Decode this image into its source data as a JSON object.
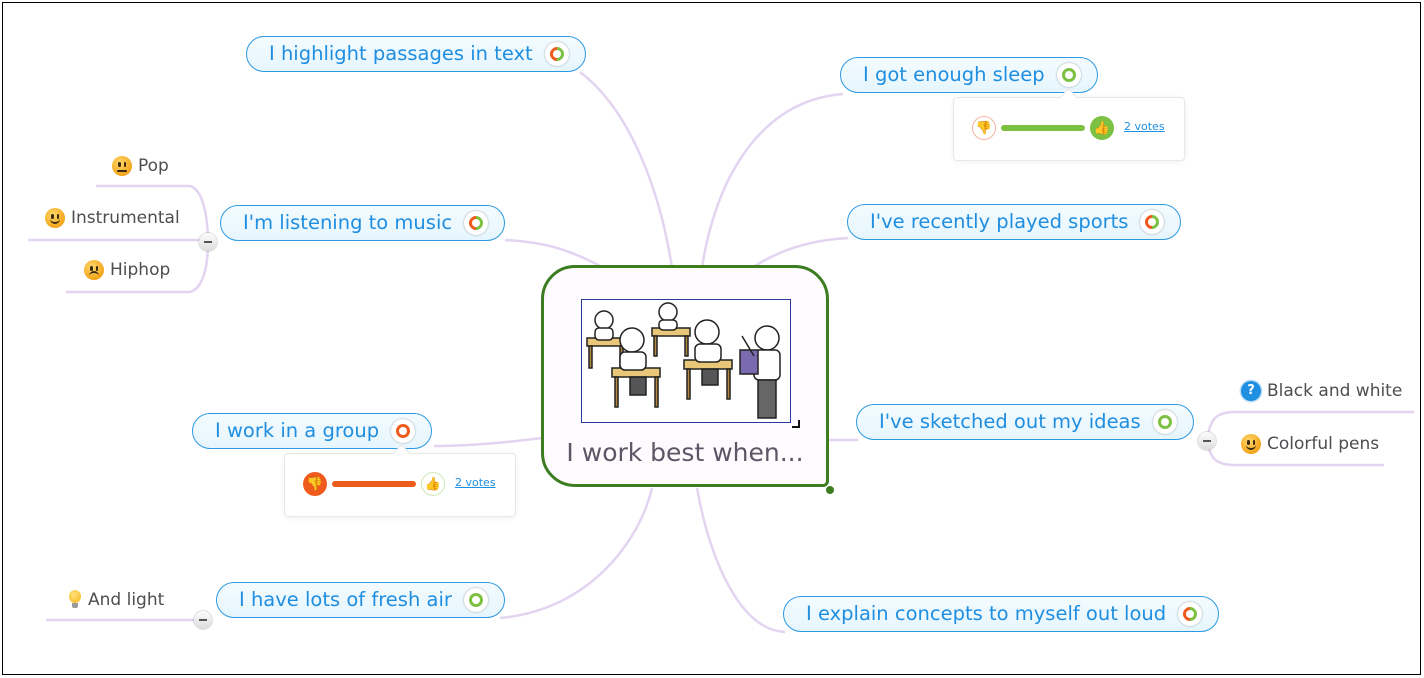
{
  "central": {
    "title": "I work best when...",
    "image": "classroom-illustration"
  },
  "colors": {
    "topic_border": "#2d9ae0",
    "topic_text": "#1f8ee0",
    "link": "#e3d4f1",
    "central_border": "#3c7d20",
    "vote_green": "#7dc142",
    "vote_orange": "#ef5b1d"
  },
  "topics": [
    {
      "id": "highlight",
      "label": "I highlight passages in text",
      "vote_state": "mixed"
    },
    {
      "id": "sleep",
      "label": "I got enough sleep",
      "vote_state": "positive",
      "vote_popup": {
        "votes_label": "2 votes",
        "up_fraction": 1.0
      }
    },
    {
      "id": "music",
      "label": "I'm listening to music",
      "vote_state": "mixed",
      "children": [
        {
          "label": "Pop",
          "icon": "neutral-face-icon"
        },
        {
          "label": "Instrumental",
          "icon": "smiley-face-icon"
        },
        {
          "label": "Hiphop",
          "icon": "sad-face-icon"
        }
      ]
    },
    {
      "id": "sports",
      "label": "I've recently played sports",
      "vote_state": "mixed"
    },
    {
      "id": "group",
      "label": "I work in a group",
      "vote_state": "negative",
      "vote_popup": {
        "votes_label": "2 votes",
        "up_fraction": 0.0
      }
    },
    {
      "id": "sketched",
      "label": "I've sketched out my ideas",
      "vote_state": "positive",
      "children": [
        {
          "label": "Black and white",
          "icon": "question-icon"
        },
        {
          "label": "Colorful pens",
          "icon": "smiley-face-icon"
        }
      ]
    },
    {
      "id": "freshair",
      "label": "I have lots of fresh air",
      "vote_state": "positive",
      "children": [
        {
          "label": "And light",
          "icon": "lightbulb-icon"
        }
      ]
    },
    {
      "id": "explain",
      "label": "I explain concepts to myself out loud",
      "vote_state": "mixed"
    }
  ]
}
